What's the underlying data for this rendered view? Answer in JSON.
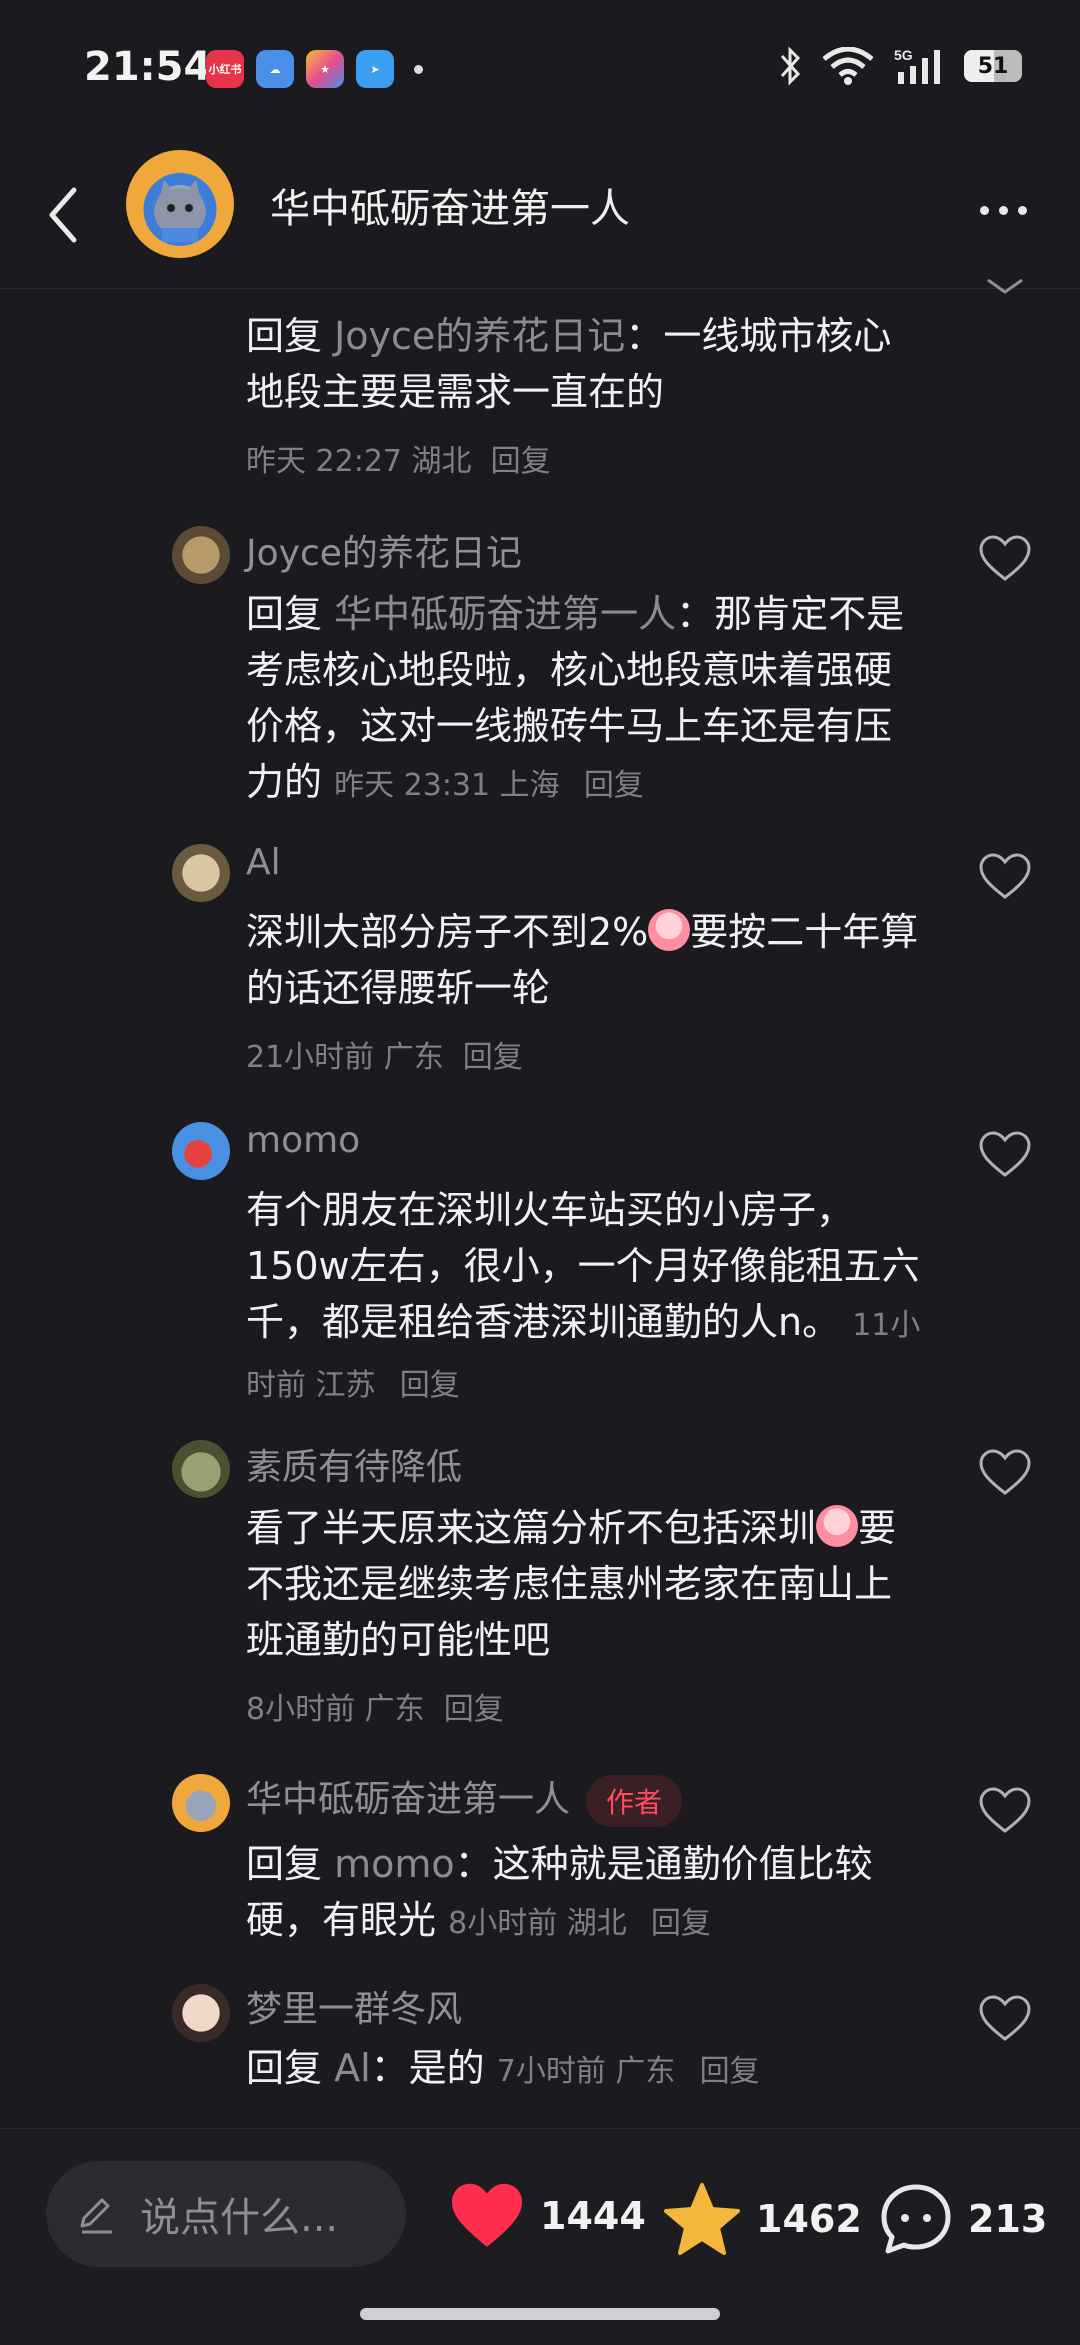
{
  "status": {
    "time": "21:54",
    "battery": "51",
    "network": "5G"
  },
  "header": {
    "title": "华中砥砺奋进第一人"
  },
  "comments": [
    {
      "name": "",
      "reply_prefix": "回复 ",
      "reply_to": "Joyce的养花日记",
      "text": "：一线城市核心地段主要是需求一直在的",
      "meta": "昨天 22:27 湖北",
      "reply_label": "回复"
    },
    {
      "name": "Joyce的养花日记",
      "reply_prefix": "回复 ",
      "reply_to": "华中砥砺奋进第一人",
      "text": "：那肯定不是考虑核心地段啦，核心地段意味着强硬价格，这对一线搬砖牛马上车还是有压力的",
      "meta": "昨天 23:31 上海",
      "reply_label": "回复"
    },
    {
      "name": "Al",
      "text_before_emoji": "深圳大部分房子不到2%",
      "text_after_emoji": "要按二十年算的话还得腰斩一轮",
      "meta": "21小时前 广东",
      "reply_label": "回复"
    },
    {
      "name": "momo",
      "text": "有个朋友在深圳火车站买的小房子，150w左右，很小，一个月好像能租五六千，都是租给香港深圳通勤的人n。",
      "meta": "11小时前 江苏",
      "reply_label": "回复"
    },
    {
      "name": "素质有待降低",
      "text_before_emoji": "看了半天原来这篇分析不包括深圳",
      "text_after_emoji": "要不我还是继续考虑住惠州老家在南山上班通勤的可能性吧",
      "meta": "8小时前 广东",
      "reply_label": "回复"
    },
    {
      "name": "华中砥砺奋进第一人",
      "author_tag": "作者",
      "reply_prefix": "回复 ",
      "reply_to": "momo",
      "text": "：这种就是通勤价值比较硬，有眼光",
      "meta": "8小时前 湖北",
      "reply_label": "回复"
    },
    {
      "name": "梦里一群冬风",
      "reply_prefix": "回复 ",
      "reply_to": "Al",
      "text": "：是的",
      "meta": "7小时前 广东",
      "reply_label": "回复"
    }
  ],
  "bottom": {
    "input_placeholder": "说点什么...",
    "likes": "1444",
    "stars": "1462",
    "comments": "213"
  },
  "colors": {
    "background": "#1b1b1f",
    "like_red": "#ff2e4d",
    "star_yellow": "#f5b73b",
    "author_tag": "#ff4d5e"
  }
}
